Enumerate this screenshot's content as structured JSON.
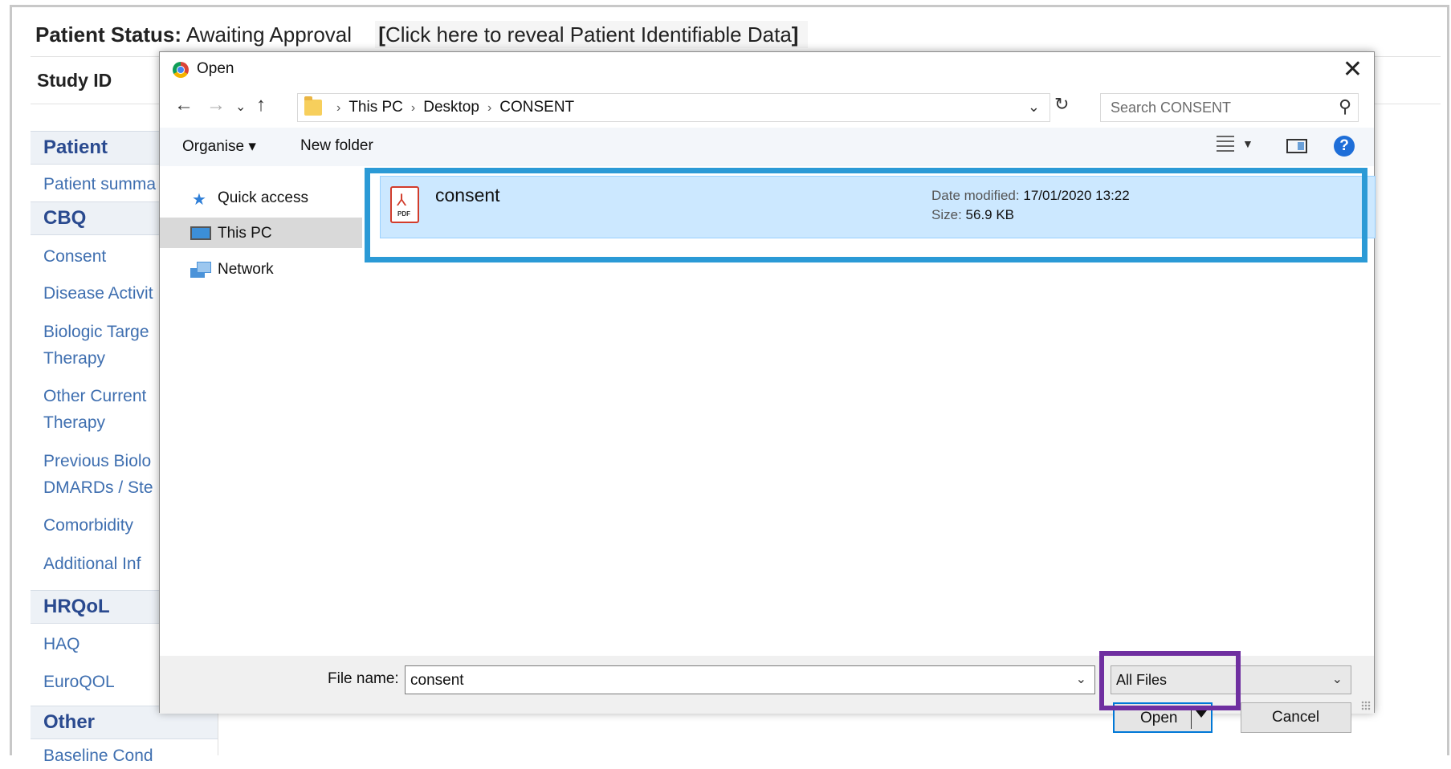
{
  "app": {
    "status_label": "Patient Status:",
    "status_value": "Awaiting Approval",
    "reveal_prefix": "[",
    "reveal_text": "Click here to reveal Patient Identifiable Data",
    "reveal_suffix": "]",
    "study_id_label": "Study ID"
  },
  "sidebar": {
    "sections": [
      {
        "title": "Patient"
      },
      {
        "title": "CBQ"
      },
      {
        "title": "HRQoL"
      },
      {
        "title": "Other"
      }
    ],
    "items": [
      "Patient summa",
      "Consent",
      "Disease Activit",
      "Biologic Targe",
      "Therapy",
      "Other Current",
      "Therapy",
      "Previous Biolo",
      "DMARDs / Ste",
      "Comorbidity",
      "Additional Inf",
      "HAQ",
      "EuroQOL",
      "Baseline Cond"
    ]
  },
  "dialog": {
    "title": "Open",
    "close_glyph": "✕",
    "nav": {
      "back": "←",
      "forward": "→",
      "recent": "⌄",
      "up": "↑"
    },
    "breadcrumbs": [
      "This PC",
      "Desktop",
      "CONSENT"
    ],
    "crumb_sep": "›",
    "search_placeholder": "Search CONSENT",
    "toolbar": {
      "organise": "Organise ▾",
      "new_folder": "New folder",
      "help": "?"
    },
    "nav_pane": [
      {
        "label": "Quick access",
        "icon": "star-icon",
        "glyph": "★"
      },
      {
        "label": "This PC",
        "icon": "computer-icon"
      },
      {
        "label": "Network",
        "icon": "network-icon"
      }
    ],
    "file": {
      "name": "consent",
      "icon": "pdf-icon",
      "pdf_label": "PDF",
      "date_label": "Date modified:",
      "date_value": "17/01/2020 13:22",
      "size_label": "Size:",
      "size_value": "56.9 KB"
    },
    "footer": {
      "file_name_label": "File name:",
      "file_name_value": "consent",
      "file_type_value": "All Files",
      "open_label": "Open",
      "cancel_label": "Cancel"
    }
  },
  "colors": {
    "highlight_blue": "#2b9ad6",
    "highlight_purple": "#6f2fa0",
    "selected_row": "#cce8ff"
  }
}
